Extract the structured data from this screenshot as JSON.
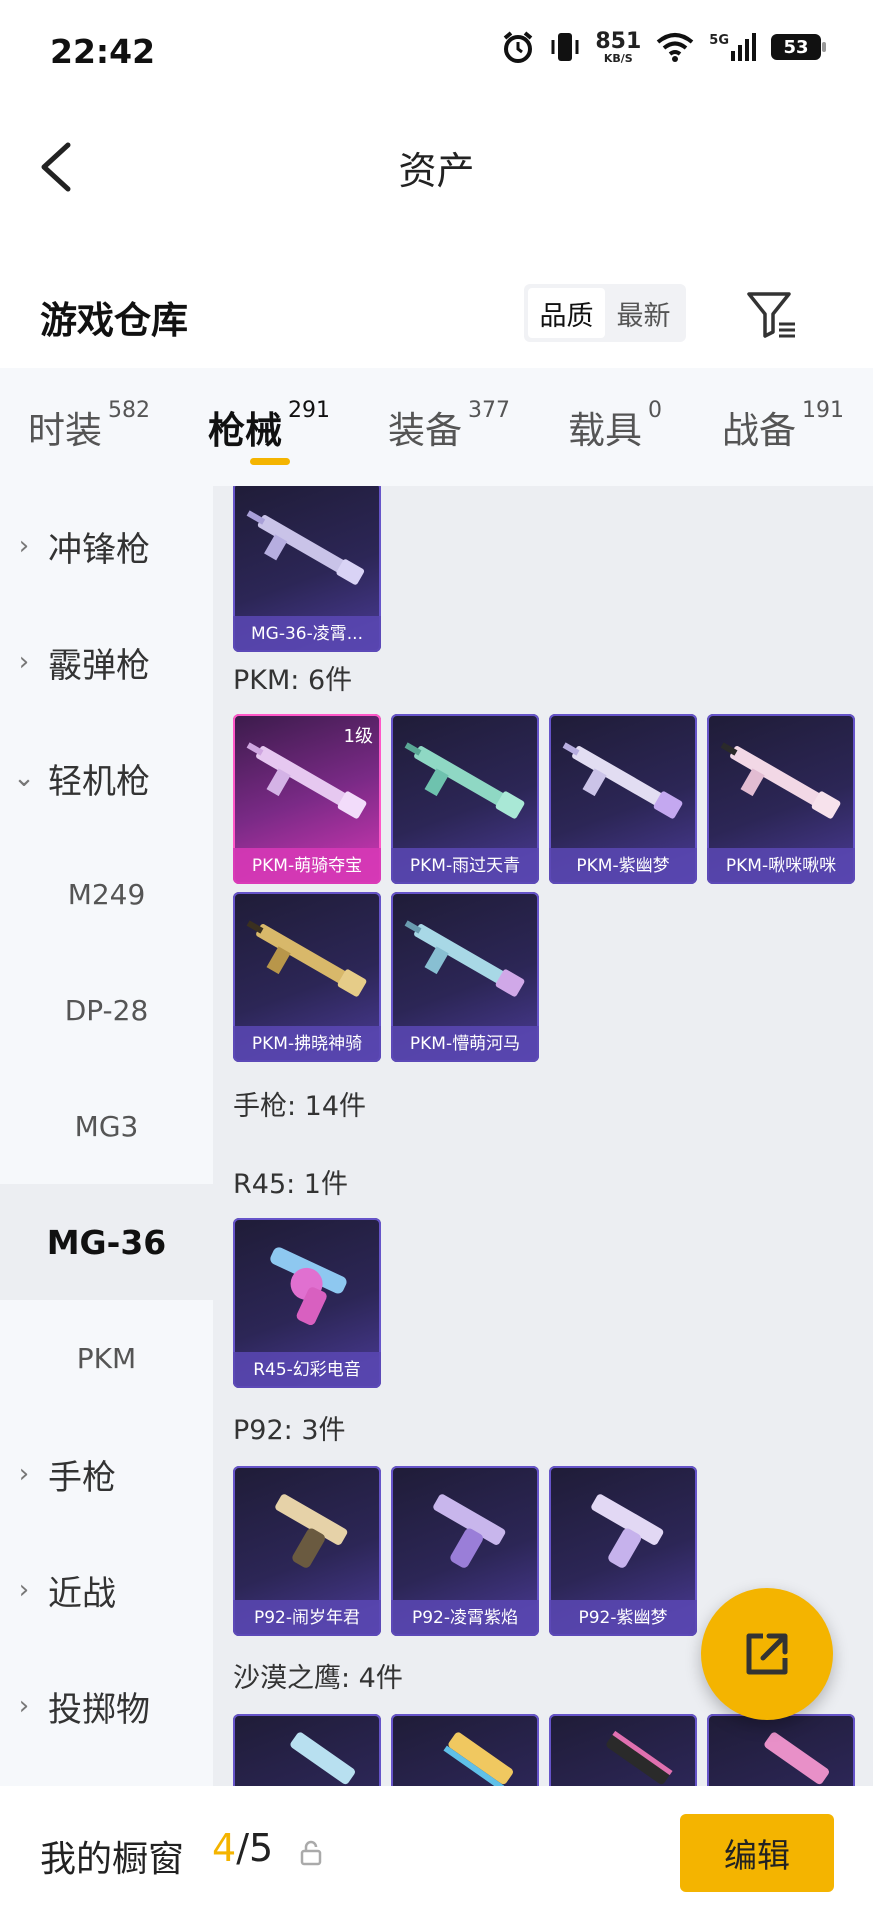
{
  "status_bar": {
    "time": "22:42",
    "net_speed": "851",
    "net_unit": "KB/S",
    "network": "5G",
    "battery": "53"
  },
  "header": {
    "title": "资产"
  },
  "warehouse": {
    "title": "游戏仓库",
    "sort_options": [
      "品质",
      "最新"
    ],
    "active_sort": "品质"
  },
  "tabs": [
    {
      "label": "时装",
      "count": "582"
    },
    {
      "label": "枪械",
      "count": "291",
      "active": true
    },
    {
      "label": "装备",
      "count": "377"
    },
    {
      "label": "载具",
      "count": "0"
    },
    {
      "label": "战备",
      "count": "191"
    }
  ],
  "sidebar": {
    "categories": [
      "冲锋枪",
      "霰弹枪",
      "轻机枪",
      "手枪",
      "近战",
      "投掷物"
    ],
    "subcategories": [
      "M249",
      "DP-28",
      "MG3",
      "MG-36",
      "PKM"
    ],
    "active_sub": "MG-36"
  },
  "content": {
    "top_card": "MG-36-凌霄...",
    "pkm_label": "PKM: 6件",
    "pkm_items": [
      "PKM-萌骑夺宝",
      "PKM-雨过天青",
      "PKM-紫幽梦",
      "PKM-啾咪啾咪",
      "PKM-拂晓神骑",
      "PKM-懵萌河马"
    ],
    "pkm_level": "1级",
    "pistol_label": "手枪: 14件",
    "r45_label": "R45: 1件",
    "r45_items": [
      "R45-幻彩电音"
    ],
    "p92_label": "P92: 3件",
    "p92_items": [
      "P92-闹岁年君",
      "P92-凌霄紫焰",
      "P92-紫幽梦"
    ],
    "deagle_label": "沙漠之鹰: 4件"
  },
  "bottom": {
    "showcase_label": "我的橱窗",
    "current": "4",
    "total": "5",
    "edit_label": "编辑"
  },
  "colors": {
    "accent": "#f4b400",
    "card_purple": "#4c3c99",
    "card_pink": "#d638b6"
  }
}
